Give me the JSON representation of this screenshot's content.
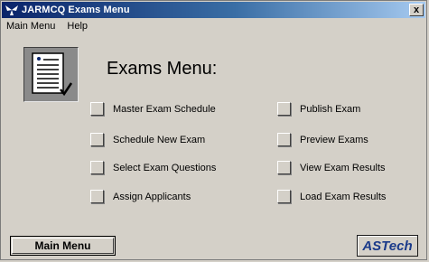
{
  "window": {
    "title": "JARMCQ Exams Menu",
    "close_glyph": "x"
  },
  "menubar": {
    "items": [
      {
        "label": "Main Menu"
      },
      {
        "label": "Help"
      }
    ]
  },
  "main": {
    "heading": "Exams Menu:",
    "icon": "document-checklist-icon",
    "left_options": [
      {
        "label": "Master Exam Schedule"
      },
      {
        "label": "Schedule New Exam"
      },
      {
        "label": "Select Exam Questions"
      },
      {
        "label": "Assign Applicants"
      }
    ],
    "right_options": [
      {
        "label": "Publish Exam"
      },
      {
        "label": "Preview Exams"
      },
      {
        "label": "View Exam Results"
      },
      {
        "label": "Load Exam Results"
      }
    ]
  },
  "footer": {
    "main_menu_button": "Main Menu",
    "logo_text": "ASTech"
  },
  "colors": {
    "titlebar_start": "#0a246a",
    "titlebar_end": "#a6caf0",
    "face": "#d4d0c8",
    "logo_text": "#1a3a8a"
  }
}
